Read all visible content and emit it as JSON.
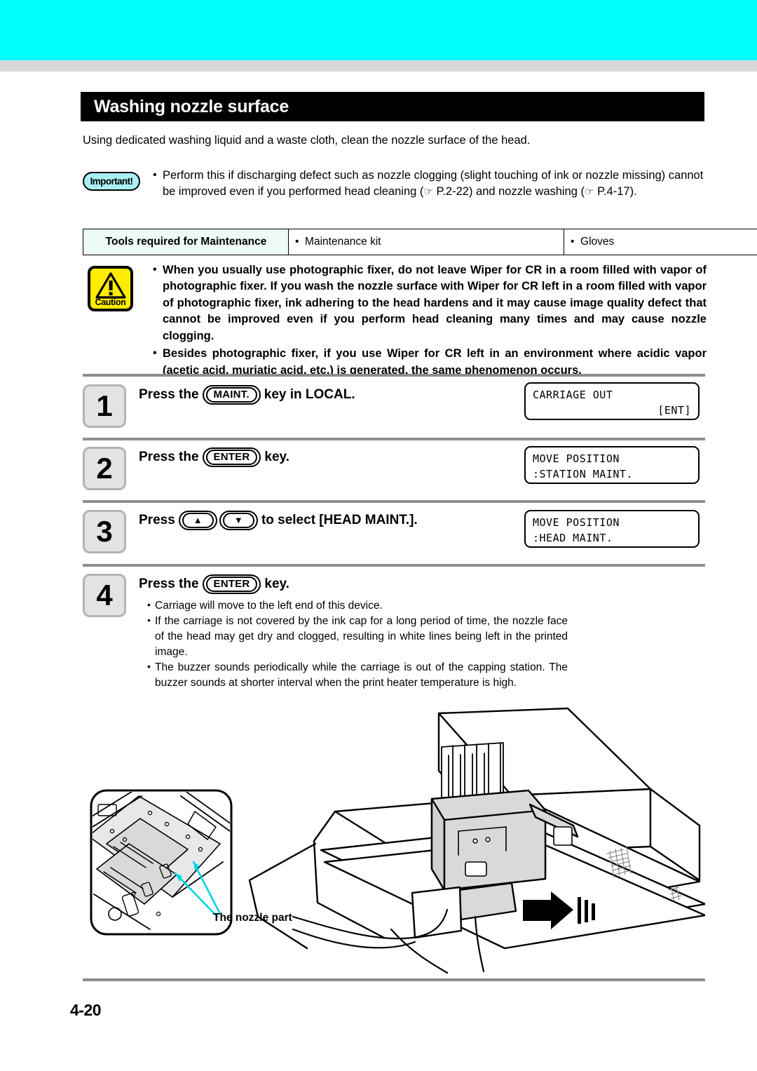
{
  "header": {
    "band_color": "#00ffff",
    "sub_band_color": "#d9d9d9"
  },
  "section": {
    "title": "Washing nozzle surface",
    "intro": "Using dedicated washing liquid and a waste cloth, clean the nozzle surface of the head."
  },
  "important": {
    "icon_label": "Important!",
    "icon_color": "#aaf0f5",
    "bullet": "Perform this if discharging defect such as nozzle clogging (slight touching of ink or nozzle missing) cannot be improved even if you performed head cleaning (",
    "ref1": "P.2-22",
    "mid": ") and nozzle washing (",
    "ref2": "P.4-17",
    "tail": ")."
  },
  "tools_table": {
    "header": "Tools required for Maintenance",
    "items": [
      "Maintenance kit",
      "Gloves"
    ],
    "header_bg": "#eefaf4"
  },
  "caution": {
    "icon_label": "Caution",
    "icon_color": "#ffec00",
    "bullets": [
      "When you usually use photographic fixer, do not leave Wiper for CR in a room filled with vapor of photographic fixer. If you wash the nozzle surface with Wiper for CR left in a room filled with vapor of photographic fixer, ink adhering to the head hardens and it may cause image quality defect that cannot be improved even if you perform head cleaning many times and may cause nozzle clogging.",
      "Besides photographic fixer, if you use Wiper for CR left in an environment where acidic vapor (acetic acid, muriatic acid, etc.) is generated, the same phenomenon occurs."
    ]
  },
  "steps": [
    {
      "number": "1",
      "text_before": "Press the",
      "key": "MAINT.",
      "text_after": "key in LOCAL.",
      "lcd_line1": "CARRIAGE OUT",
      "lcd_line2": "[ENT]"
    },
    {
      "number": "2",
      "text_before": "Press the",
      "key": "ENTER",
      "text_after": "key.",
      "lcd_line1": "MOVE POSITION",
      "lcd_line2": ":STATION MAINT."
    },
    {
      "number": "3",
      "text_before": "Press",
      "key_up": "▲",
      "key_down": "▼",
      "text_after": "to select [HEAD MAINT.].",
      "lcd_line1": "MOVE POSITION",
      "lcd_line2": ":HEAD MAINT."
    },
    {
      "number": "4",
      "text_before": "Press the",
      "key": "ENTER",
      "text_after": "key.",
      "sub_bullets": [
        "Carriage will move to the left end of this device.",
        "If the carriage is not covered by the ink cap for a long period of time, the nozzle face of the head may get dry and clogged, resulting in white lines being left in the printed image.",
        "The buzzer sounds periodically while the carriage is out of the capping station. The buzzer sounds at shorter interval when the print heater temperature is high."
      ]
    }
  ],
  "illustration": {
    "callout_label": "The nozzle part",
    "accent_color": "#00d5e6",
    "shade_color": "#d9d9d9"
  },
  "footer": {
    "page_number": "4-20"
  }
}
